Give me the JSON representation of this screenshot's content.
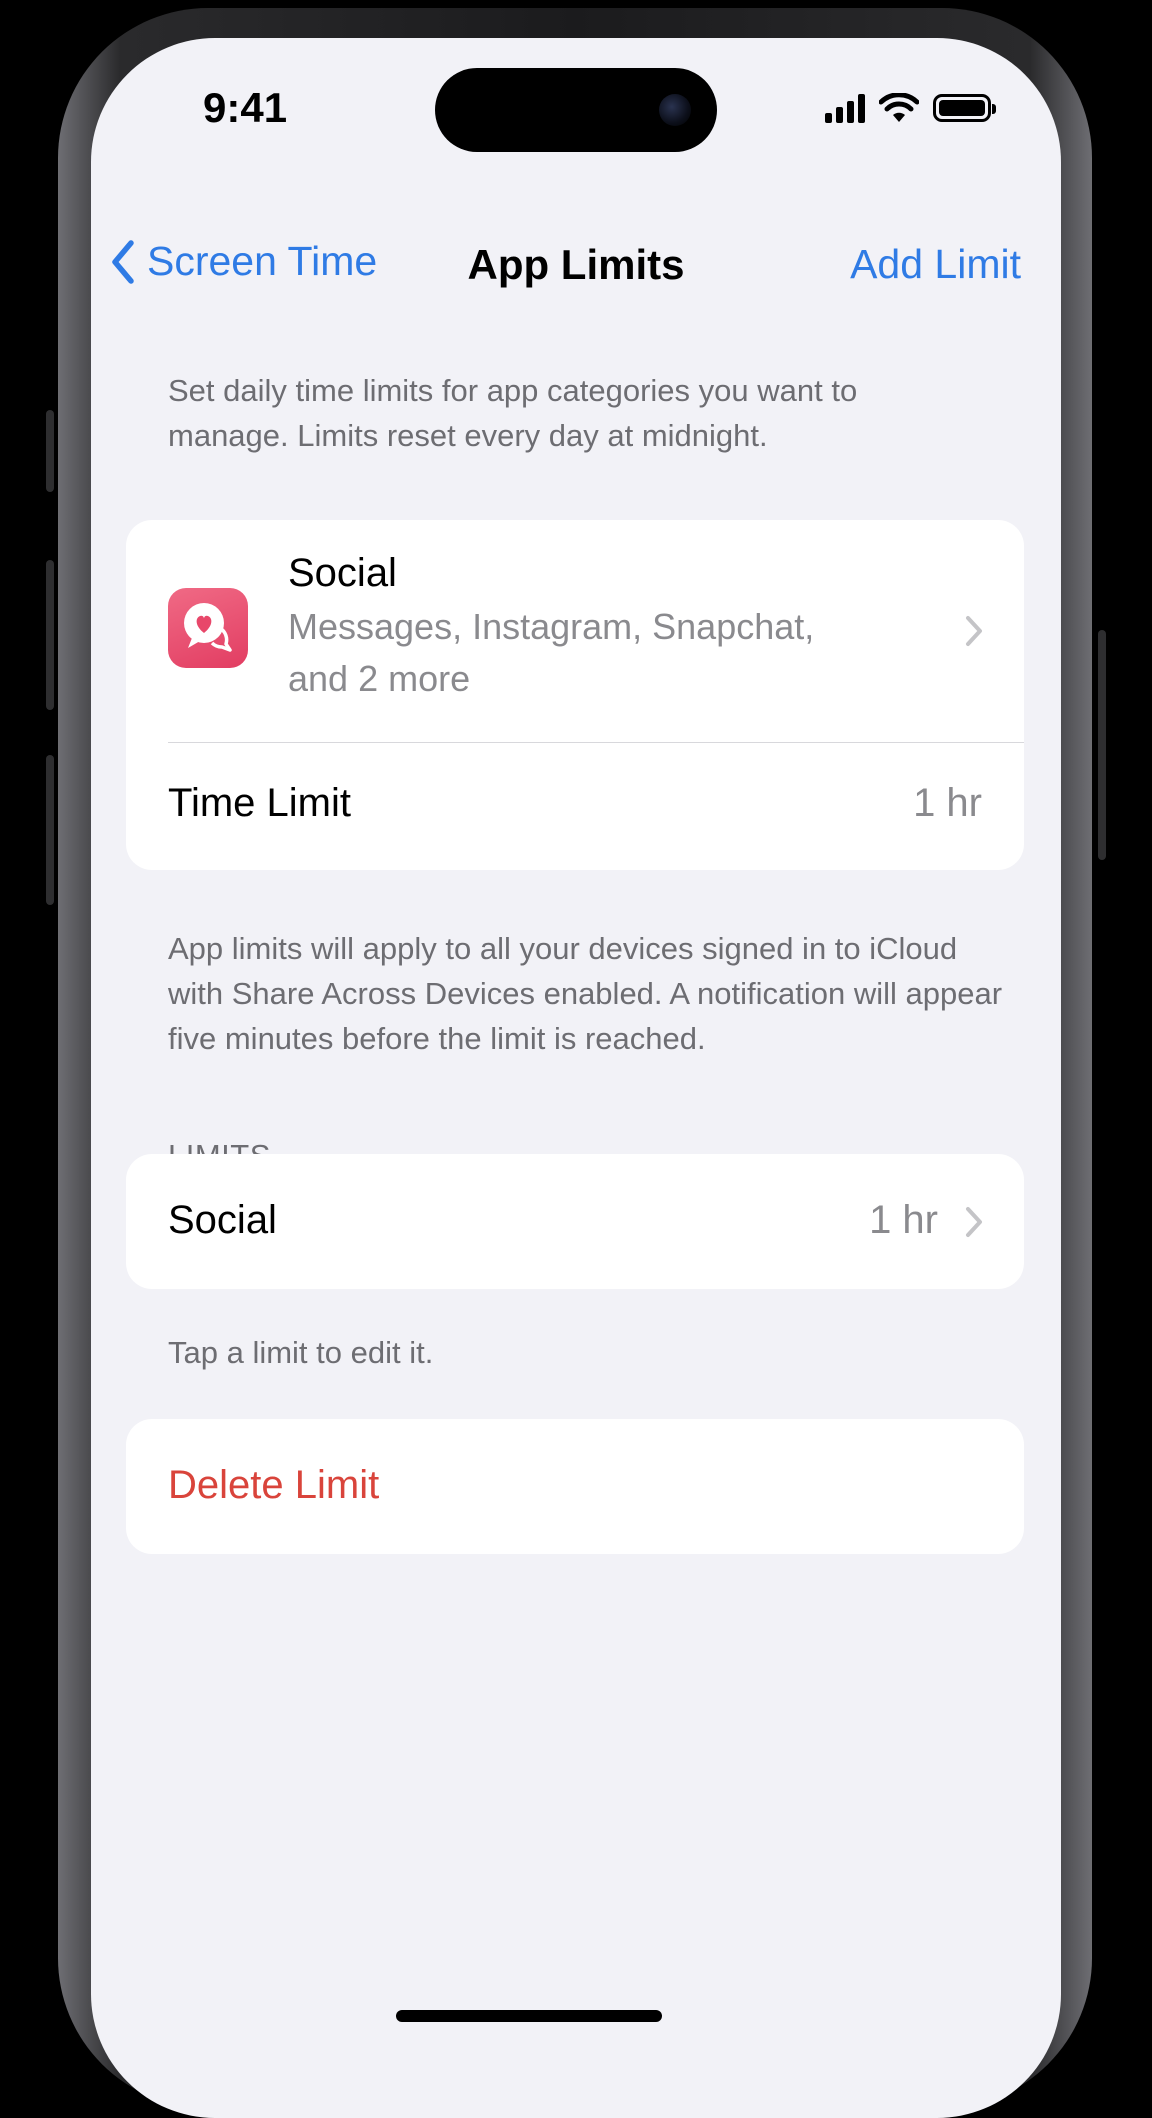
{
  "status_bar": {
    "time": "9:41"
  },
  "nav": {
    "back_label": "Screen Time",
    "title": "App Limits",
    "action_label": "Add Limit"
  },
  "intro_text": "Set daily time limits for app categories you want to manage. Limits reset every day at midnight.",
  "category_card": {
    "icon": "chat-heart-icon",
    "title": "Social",
    "apps_line1": "Messages, Instagram, Snapchat,",
    "apps_line2": "and 2 more",
    "time_limit_label": "Time Limit",
    "time_limit_value": "1 hr"
  },
  "devices_note": "App limits will apply to all your devices signed in to iCloud with Share Across Devices enabled. A notification will appear five minutes before the limit is reached.",
  "limits_section": {
    "header": "LIMITS",
    "items": [
      {
        "label": "Social",
        "value": "1 hr"
      }
    ],
    "footer": "Tap a limit to edit it."
  },
  "delete_button": {
    "label": "Delete Limit"
  },
  "colors": {
    "accent": "#2f7be5",
    "destructive": "#d9443b",
    "background": "#f2f2f7",
    "icon_pink": "#e8476a"
  }
}
